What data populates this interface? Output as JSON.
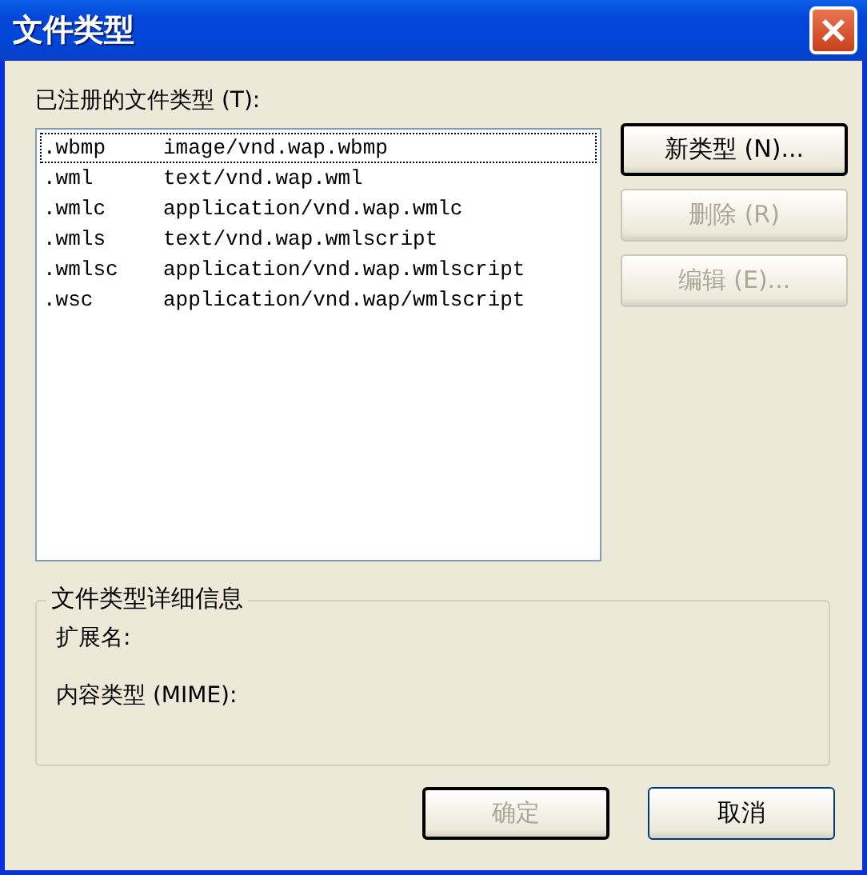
{
  "window": {
    "title": "文件类型"
  },
  "list_label": "已注册的文件类型 (T):",
  "file_types": [
    {
      "extension": ".wbmp",
      "mime": "image/vnd.wap.wbmp",
      "focused": true
    },
    {
      "extension": ".wml",
      "mime": "text/vnd.wap.wml",
      "focused": false
    },
    {
      "extension": ".wmlc",
      "mime": "application/vnd.wap.wmlc",
      "focused": false
    },
    {
      "extension": ".wmls",
      "mime": "text/vnd.wap.wmlscript",
      "focused": false
    },
    {
      "extension": ".wmlsc",
      "mime": "application/vnd.wap.wmlscript",
      "focused": false
    },
    {
      "extension": ".wsc",
      "mime": "application/vnd.wap/wmlscript",
      "focused": false
    }
  ],
  "side_buttons": [
    {
      "label": "新类型 (N)...",
      "disabled": false,
      "default": true
    },
    {
      "label": "删除 (R)",
      "disabled": true,
      "default": false
    },
    {
      "label": "编辑 (E)...",
      "disabled": true,
      "default": false
    }
  ],
  "details": {
    "title": "文件类型详细信息",
    "fields": [
      "扩展名:",
      "内容类型 (MIME):"
    ]
  },
  "footer_buttons": [
    {
      "label": "确定",
      "disabled": true,
      "default": true
    },
    {
      "label": "取消",
      "disabled": false,
      "default": false
    }
  ]
}
